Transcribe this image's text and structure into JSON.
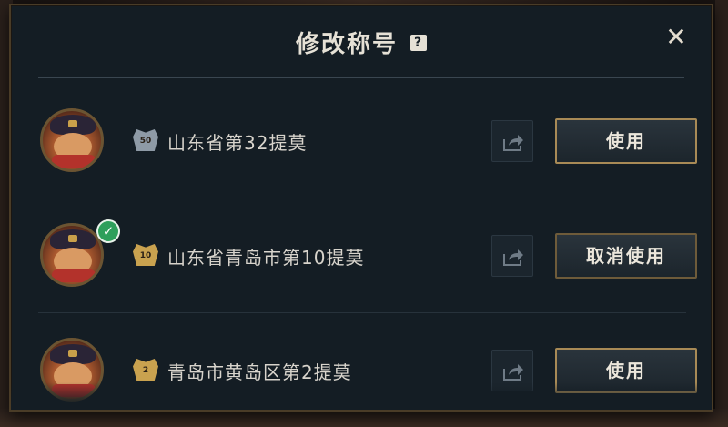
{
  "dialog": {
    "title": "修改称号",
    "help_glyph": "?",
    "close_glyph": "✕"
  },
  "titles": [
    {
      "label": "山东省第32提莫",
      "badge_level": "50",
      "badge_color": "#8e9aa6",
      "in_use": false,
      "button": "使用"
    },
    {
      "label": "山东省青岛市第10提莫",
      "badge_level": "10",
      "badge_color": "#c9a24f",
      "in_use": true,
      "button": "取消使用"
    },
    {
      "label": "青岛市黄岛区第2提莫",
      "badge_level": "2",
      "badge_color": "#c9a24f",
      "in_use": false,
      "button": "使用"
    }
  ],
  "colors": {
    "panel_bg": "#141d24",
    "border_gold": "#a88a56",
    "text": "#d8d4cc",
    "check_green": "#2e9f5b"
  },
  "icons": {
    "share": "share-icon",
    "close": "close-icon",
    "help": "help-icon",
    "check": "check-icon"
  }
}
